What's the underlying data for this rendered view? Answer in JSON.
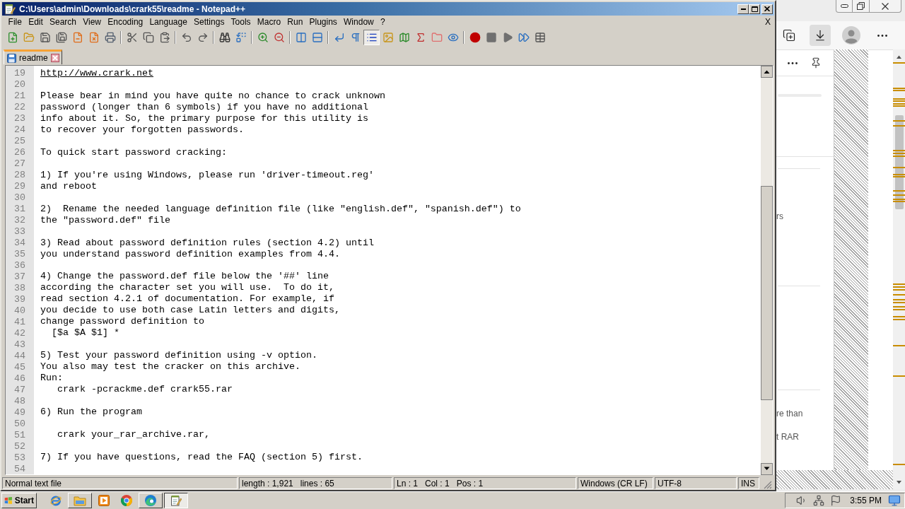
{
  "notepad": {
    "title": "C:\\Users\\admin\\Downloads\\crark55\\readme - Notepad++",
    "menu": [
      "File",
      "Edit",
      "Search",
      "View",
      "Encoding",
      "Language",
      "Settings",
      "Tools",
      "Macro",
      "Run",
      "Plugins",
      "Window",
      "?"
    ],
    "close_doc": "X",
    "toolbar": [
      {
        "buttons": [
          {
            "kind": "new",
            "on": false
          },
          {
            "kind": "open",
            "on": false
          },
          {
            "kind": "save",
            "on": false
          },
          {
            "kind": "save_all",
            "on": false
          },
          {
            "kind": "close",
            "on": false
          },
          {
            "kind": "close_all",
            "on": false
          },
          {
            "kind": "print",
            "on": false
          }
        ]
      },
      {
        "buttons": [
          {
            "kind": "cut",
            "on": false
          },
          {
            "kind": "copy",
            "on": false
          },
          {
            "kind": "paste",
            "on": false
          }
        ]
      },
      {
        "buttons": [
          {
            "kind": "undo",
            "on": false
          },
          {
            "kind": "redo",
            "on": false
          }
        ]
      },
      {
        "buttons": [
          {
            "kind": "find",
            "on": false
          },
          {
            "kind": "replace",
            "on": false
          }
        ]
      },
      {
        "buttons": [
          {
            "kind": "zoom_in",
            "on": false
          },
          {
            "kind": "zoom_out",
            "on": false
          }
        ]
      },
      {
        "buttons": [
          {
            "kind": "sync_v",
            "on": false
          },
          {
            "kind": "sync_h",
            "on": false
          }
        ]
      },
      {
        "buttons": [
          {
            "kind": "wrap",
            "on": false
          },
          {
            "kind": "all_chars",
            "on": false
          },
          {
            "kind": "indent",
            "on": true
          },
          {
            "kind": "udl",
            "on": false
          },
          {
            "kind": "doc_map",
            "on": false
          },
          {
            "kind": "function_list",
            "on": false
          },
          {
            "kind": "workspace",
            "on": false
          },
          {
            "kind": "monitoring",
            "on": false
          }
        ]
      },
      {
        "buttons": [
          {
            "kind": "record",
            "on": false
          },
          {
            "kind": "stop",
            "on": false
          },
          {
            "kind": "play",
            "on": false
          },
          {
            "kind": "play_multi",
            "on": false
          },
          {
            "kind": "save_macro",
            "on": false
          }
        ]
      }
    ],
    "tabs": [
      {
        "label": "readme",
        "selected": true
      }
    ],
    "lines": [
      {
        "number": "19",
        "kind": "link",
        "text": "http://www.crark.net"
      },
      {
        "number": "20",
        "kind": "blank"
      },
      {
        "number": "21",
        "kind": "text",
        "text": "Please bear in mind you have quite no chance to crack unknown"
      },
      {
        "number": "22",
        "kind": "text",
        "text": "password (longer than 6 symbols) if you have no additional"
      },
      {
        "number": "23",
        "kind": "text",
        "text": "info about it. So, the primary purpose for this utility is"
      },
      {
        "number": "24",
        "kind": "text",
        "text": "to recover your forgotten passwords."
      },
      {
        "number": "25",
        "kind": "blank"
      },
      {
        "number": "26",
        "kind": "text",
        "text": "To quick start password cracking:"
      },
      {
        "number": "27",
        "kind": "blank"
      },
      {
        "number": "28",
        "kind": "text",
        "text": "1) If you're using Windows, please run 'driver-timeout.reg'"
      },
      {
        "number": "29",
        "kind": "text",
        "text": "and reboot"
      },
      {
        "number": "30",
        "kind": "blank"
      },
      {
        "number": "31",
        "kind": "text",
        "text": "2)  Rename the needed language definition file (like \"english.def\", \"spanish.def\") to"
      },
      {
        "number": "32",
        "kind": "text",
        "text": "the \"password.def\" file"
      },
      {
        "number": "33",
        "kind": "blank"
      },
      {
        "number": "34",
        "kind": "text",
        "text": "3) Read about password definition rules (section 4.2) until"
      },
      {
        "number": "35",
        "kind": "text",
        "text": "you understand password definition examples from 4.4."
      },
      {
        "number": "36",
        "kind": "blank"
      },
      {
        "number": "37",
        "kind": "text",
        "text": "4) Change the password.def file below the '##' line"
      },
      {
        "number": "38",
        "kind": "text",
        "text": "according the character set you will use.  To do it,"
      },
      {
        "number": "39",
        "kind": "text",
        "text": "read section 4.2.1 of documentation. For example, if"
      },
      {
        "number": "40",
        "kind": "text",
        "text": "you decide to use both case Latin letters and digits,"
      },
      {
        "number": "41",
        "kind": "text",
        "text": "change password definition to"
      },
      {
        "number": "42",
        "kind": "text",
        "text": "  [$a $A $1] *"
      },
      {
        "number": "43",
        "kind": "blank"
      },
      {
        "number": "44",
        "kind": "text",
        "text": "5) Test your password definition using -v option."
      },
      {
        "number": "45",
        "kind": "text",
        "text": "You also may test the cracker on this archive."
      },
      {
        "number": "46",
        "kind": "text",
        "text": "Run:"
      },
      {
        "number": "47",
        "kind": "text",
        "text": "   crark -pcrackme.def crark55.rar"
      },
      {
        "number": "48",
        "kind": "blank"
      },
      {
        "number": "49",
        "kind": "text",
        "text": "6) Run the program"
      },
      {
        "number": "50",
        "kind": "blank"
      },
      {
        "number": "51",
        "kind": "text",
        "text": "   crark your_rar_archive.rar,"
      },
      {
        "number": "52",
        "kind": "blank"
      },
      {
        "number": "53",
        "kind": "text",
        "text": "7) If you have questions, read the FAQ (section 5) first."
      },
      {
        "number": "54",
        "kind": "blank"
      }
    ],
    "status_bar": [
      {
        "texts": [
          "Normal text file"
        ]
      },
      {
        "texts": [
          "length : 1,921",
          "lines : 65"
        ]
      },
      {
        "texts": [
          "Ln : 1",
          "Col : 1",
          "Pos : 1"
        ]
      },
      {
        "texts": [
          "Windows (CR LF)"
        ]
      },
      {
        "texts": [
          "UTF-8"
        ]
      },
      {
        "texts": [
          "INS"
        ]
      }
    ]
  },
  "browser": {
    "toolbar": [
      {
        "kind": "tabs",
        "selected": false
      },
      {
        "kind": "downloads",
        "selected": true
      },
      {
        "kind": "profile",
        "selected": false
      },
      {
        "kind": "more",
        "selected": false
      }
    ],
    "panel_texts": [
      "rs",
      "re than",
      "t RAR"
    ]
  },
  "taskbar": {
    "start": "Start",
    "apps": [
      {
        "kind": "ie",
        "running": false,
        "selected": false
      },
      {
        "kind": "explorer",
        "running": true,
        "selected": false
      },
      {
        "kind": "media",
        "running": false,
        "selected": false
      },
      {
        "kind": "chrome",
        "running": false,
        "selected": false
      },
      {
        "kind": "edge",
        "running": true,
        "selected": false
      },
      {
        "kind": "notepad",
        "running": true,
        "selected": true
      }
    ],
    "clock": "3:55 PM"
  }
}
